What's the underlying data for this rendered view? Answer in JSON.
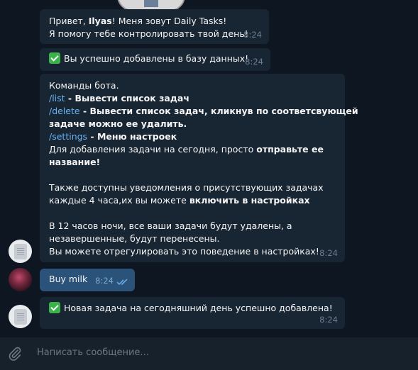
{
  "messages": [
    {
      "lines": [
        "Привет, Ilyas! Меня зовут Daily Tasks!",
        "Я помогу тебе контролировать твой день!"
      ],
      "greeting_prefix": "Привет, ",
      "greeting_name": "Ilyas",
      "greeting_rest": "! Меня зовут Daily Tasks!",
      "line2": "Я помогу тебе контролировать твой день!",
      "time": "8:24"
    },
    {
      "text": "Вы успешно добавлены в базу данных!",
      "time": "8:24"
    },
    {
      "intro": "Команды бота.",
      "cmd_list": "/list",
      "cmd_list_desc": " - Вывести список задач",
      "cmd_delete": "/delete",
      "cmd_delete_desc_1": " - Вывести список задач, кликнув по соответсвующей",
      "cmd_delete_desc_2": "задаче можно ее удалить.",
      "cmd_settings": "/settings",
      "cmd_settings_desc": " - Меню настроек",
      "add_1a": "Для добавления задачи на сегодня, просто ",
      "add_1b": "отправьте ее",
      "add_2": "название!",
      "notif_1": "Также доступны уведомления о присутствующих задачах",
      "notif_2a": "каждые 4 часа,их вы можете ",
      "notif_2b": "включить в настройках",
      "night_1": "В 12 часов ночи, все ваши задачи будут удалены, а",
      "night_2": "незавершенные, будут перенесены.",
      "night_3": "Вы можете отрегулировать это поведение в настройках!",
      "time": "8:24"
    },
    {
      "text": "Buy milk",
      "time": "8:24"
    },
    {
      "text": "Новая задача на сегодняшний день успешно добавлена!",
      "time": "8:24"
    }
  ],
  "composer": {
    "placeholder": "Написать сообщение..."
  },
  "colors": {
    "background": "#0e1621",
    "incoming": "#182533",
    "outgoing": "#2b5278",
    "link": "#6ab3f3"
  }
}
